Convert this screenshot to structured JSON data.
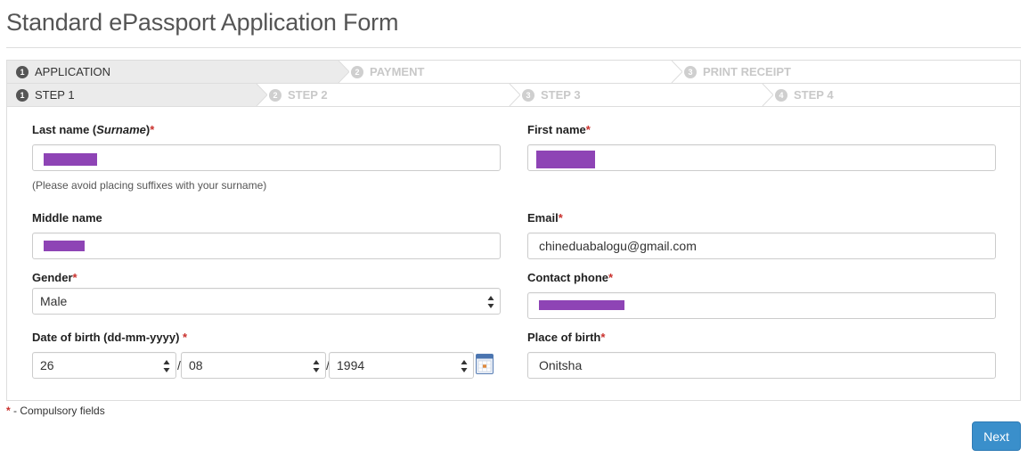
{
  "page": {
    "title": "Standard ePassport Application Form"
  },
  "main_wizard": [
    {
      "num": "1",
      "label": "APPLICATION",
      "state": "active"
    },
    {
      "num": "2",
      "label": "PAYMENT",
      "state": "inactive"
    },
    {
      "num": "3",
      "label": "PRINT RECEIPT",
      "state": "inactive"
    }
  ],
  "sub_wizard": [
    {
      "num": "1",
      "label": "STEP 1",
      "state": "active"
    },
    {
      "num": "2",
      "label": "STEP 2",
      "state": "inactive"
    },
    {
      "num": "3",
      "label": "STEP 3",
      "state": "inactive"
    },
    {
      "num": "4",
      "label": "STEP 4",
      "state": "inactive"
    }
  ],
  "form": {
    "last_name": {
      "label_prefix": "Last name (",
      "label_em": "Surname",
      "label_suffix": ")",
      "required": "*",
      "value_redacted": true,
      "help": "(Please avoid placing suffixes with your surname)"
    },
    "first_name": {
      "label": "First name",
      "required": "*",
      "value_redacted": true
    },
    "middle_name": {
      "label": "Middle name",
      "value_redacted": true
    },
    "email": {
      "label": "Email",
      "required": "*",
      "value": "chineduabalogu@gmail.com"
    },
    "gender": {
      "label": "Gender",
      "required": "*",
      "value": "Male"
    },
    "contact_phone": {
      "label": "Contact phone",
      "required": "*",
      "value_redacted": true
    },
    "dob": {
      "label": "Date of birth (dd-mm-yyyy) ",
      "required": "*",
      "day": "26",
      "month": "08",
      "year": "1994",
      "separator": "/"
    },
    "place_of_birth": {
      "label": "Place of birth",
      "required": "*",
      "value": "Onitsha"
    }
  },
  "footnote": {
    "marker": "*",
    "text": " - Compulsory fields"
  },
  "actions": {
    "next_label": "Next"
  },
  "colors": {
    "accent": "#3a8fcb",
    "redaction": "#8e44b5",
    "required": "#c9302c"
  }
}
